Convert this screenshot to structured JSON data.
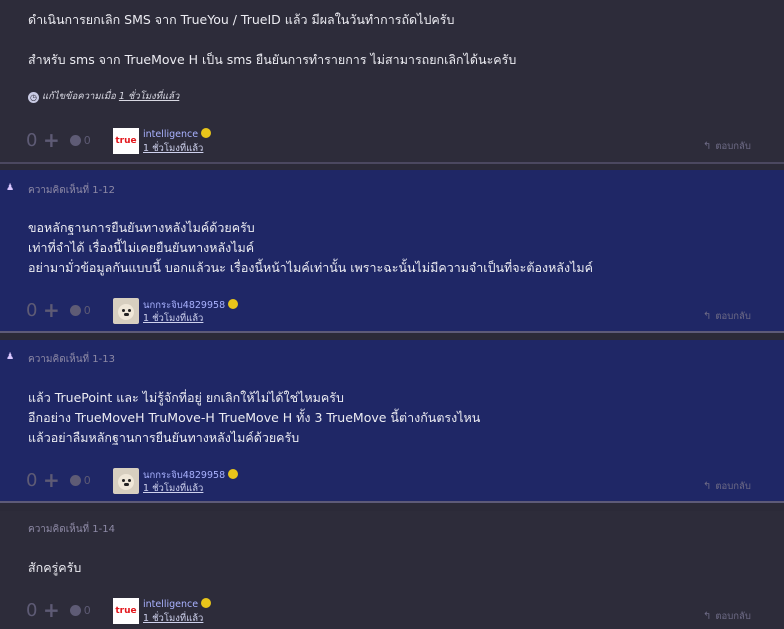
{
  "post_top": {
    "lines": [
      "ดำเนินการยกเลิก SMS จาก TrueYou / TrueID แล้ว มีผลในวันทำการถัดไปครับ",
      "สำหรับ sms จาก TrueMove H เป็น sms ยืนยันการทำรายการ ไม่สามารถยกเลิกได้นะครับ"
    ],
    "edit_prefix": "แก้ไขข้อความเมื่อ",
    "edit_time": "1 ชั่วโมงที่แล้ว",
    "votes": "0",
    "emotions": "0",
    "user": "intelligence",
    "avatar_text": "true",
    "time": "1 ชั่วโมงที่แล้ว",
    "reply": "ตอบกลับ"
  },
  "comments": [
    {
      "header": "ความคิดเห็นที่ 1-12",
      "lines": [
        "ขอหลักฐานการยืนยันทางหลังไมค์ด้วยครับ",
        "เท่าที่จำได้ เรื่องนี้ไม่เคยยืนยันทางหลังไมค์",
        "อย่ามามั่วข้อมูลกันแบบนี้ บอกแล้วนะ เรื่องนี้หน้าไมค์เท่านั้น เพราะฉะนั้นไม่มีความจำเป็นที่จะต้องหลังไมค์"
      ],
      "votes": "0",
      "emotions": "0",
      "user": "นกกระจิบ4829958",
      "time": "1 ชั่วโมงที่แล้ว",
      "reply": "ตอบกลับ"
    },
    {
      "header": "ความคิดเห็นที่ 1-13",
      "lines": [
        "แล้ว TruePoint และ ไม่รู้จักที่อยู่ ยกเลิกให้ไม่ได้ใช่ไหมครับ",
        "อีกอย่าง TrueMoveH TruMove-H TrueMove H ทั้ง 3 TrueMove นี้ต่างกันตรงไหน",
        "แล้วอย่าลืมหลักฐานการยืนยันทางหลังไมค์ด้วยครับ"
      ],
      "votes": "0",
      "emotions": "0",
      "user": "นกกระจิบ4829958",
      "time": "1 ชั่วโมงที่แล้ว",
      "reply": "ตอบกลับ"
    },
    {
      "header": "ความคิดเห็นที่ 1-14",
      "lines": [
        "สักครู่ครับ"
      ],
      "votes": "0",
      "emotions": "0",
      "user": "intelligence",
      "avatar_text": "true",
      "time": "1 ชั่วโมงที่แล้ว",
      "reply": "ตอบกลับ"
    }
  ],
  "colors": {
    "dark_bg": "#2d2c3a",
    "blue_bg": "#1f2766",
    "username": "#a9b2ff"
  }
}
